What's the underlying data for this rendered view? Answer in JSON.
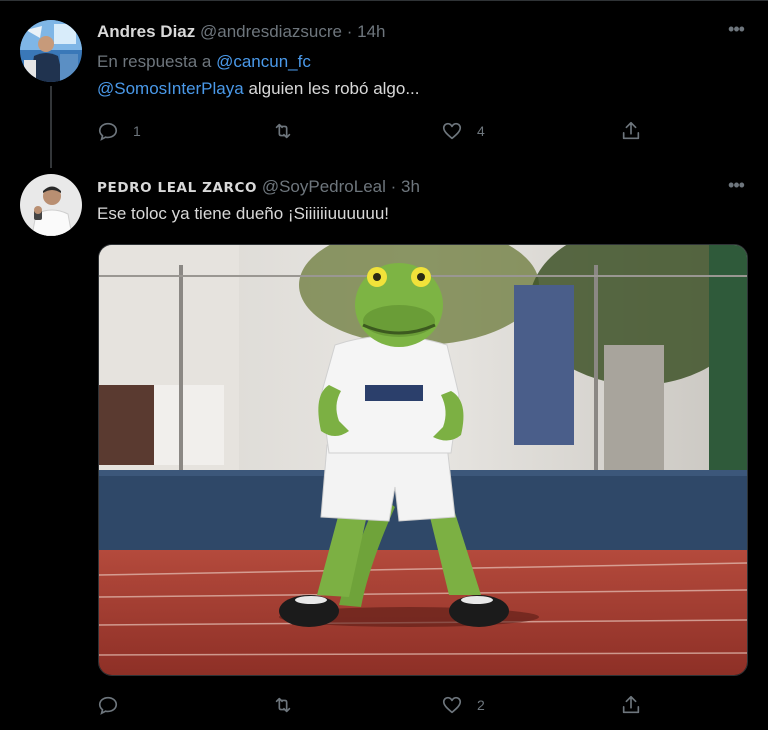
{
  "tweets": [
    {
      "display_name": "Andres Diaz",
      "handle": "@andresdiazsucre",
      "separator": "·",
      "time": "14h",
      "reply_prefix": "En respuesta a",
      "reply_to": "@cancun_fc",
      "mention": "@SomosInterPlaya",
      "text": " alguien les robó algo...",
      "reply_count": "1",
      "retweet_count": "",
      "like_count": "4"
    },
    {
      "display_name": "PEDRO LEAL ZARCO",
      "handle": "@SoyPedroLeal",
      "separator": "·",
      "time": "3h",
      "text": "Ese toloc ya tiene dueño ¡Siiiiiiuuuuuu!",
      "media_alt": "mascot-photo",
      "reply_count": "",
      "retweet_count": "",
      "like_count": "2"
    }
  ],
  "colors": {
    "background": "#000000",
    "text": "#d9d9d9",
    "muted": "#6e767d",
    "link": "#4a99e9",
    "divider": "#2f3336"
  },
  "icons": [
    "more-icon",
    "reply-icon",
    "retweet-icon",
    "like-icon",
    "share-icon"
  ]
}
